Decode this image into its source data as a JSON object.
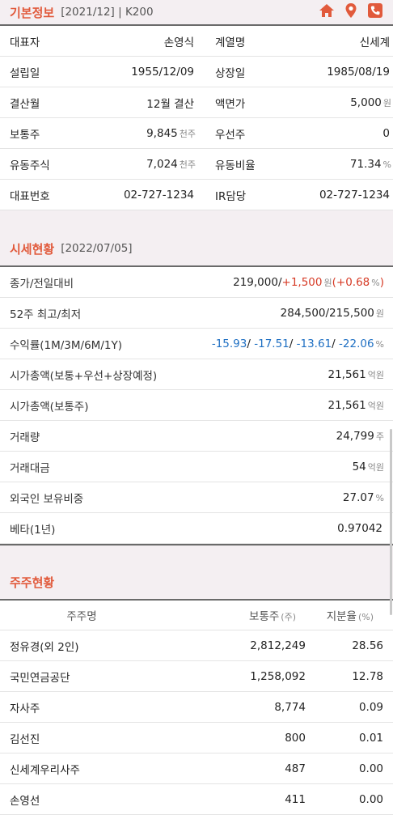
{
  "basic": {
    "title": "기본정보",
    "meta": "[2021/12]  |  K200",
    "icons": [
      "home-icon",
      "location-pin-icon",
      "phone-icon"
    ],
    "rows": [
      {
        "l1": "대표자",
        "v1": "손영식",
        "u1": "",
        "l2": "계열명",
        "v2": "신세계",
        "u2": ""
      },
      {
        "l1": "설립일",
        "v1": "1955/12/09",
        "u1": "",
        "l2": "상장일",
        "v2": "1985/08/19",
        "u2": ""
      },
      {
        "l1": "결산월",
        "v1": "12월 결산",
        "u1": "",
        "l2": "액면가",
        "v2": "5,000",
        "u2": "원"
      },
      {
        "l1": "보통주",
        "v1": "9,845",
        "u1": "천주",
        "l2": "우선주",
        "v2": "0",
        "u2": ""
      },
      {
        "l1": "유동주식",
        "v1": "7,024",
        "u1": "천주",
        "l2": "유동비율",
        "v2": "71.34",
        "u2": "%"
      },
      {
        "l1": "대표번호",
        "v1": "02-727-1234",
        "u1": "",
        "l2": "IR담당",
        "v2": "02-727-1234",
        "u2": ""
      }
    ]
  },
  "market": {
    "title": "시세현황",
    "date": "[2022/07/05]",
    "price": {
      "label": "종가/전일대비",
      "close": "219,000",
      "change": "+1,500",
      "unit": "원",
      "pct_open": "(",
      "pct": "+0.68",
      "pct_unit": "%",
      "pct_close": ")"
    },
    "week52": {
      "label": "52주 최고/최저",
      "value": "284,500/215,500",
      "unit": "원"
    },
    "returns": {
      "label": "수익률(1M/3M/6M/1Y)",
      "r1": "-15.93",
      "r2": "-17.51",
      "r3": "-13.61",
      "r4": "-22.06",
      "sep": "/",
      "unit": "%"
    },
    "rows": [
      {
        "label": "시가총액(보통+우선+상장예정)",
        "value": "21,561",
        "unit": "억원"
      },
      {
        "label": "시가총액(보통주)",
        "value": "21,561",
        "unit": "억원"
      },
      {
        "label": "거래량",
        "value": "24,799",
        "unit": "주"
      },
      {
        "label": "거래대금",
        "value": "54",
        "unit": "억원"
      },
      {
        "label": "외국인 보유비중",
        "value": "27.07",
        "unit": "%"
      },
      {
        "label": "베타(1년)",
        "value": "0.97042",
        "unit": ""
      }
    ]
  },
  "shareholders": {
    "title": "주주현황",
    "columns": {
      "name": "주주명",
      "count": "보통주",
      "count_unit": "(주)",
      "ratio": "지분율",
      "ratio_unit": "(%)"
    },
    "rows": [
      {
        "name": "정유경(외 2인)",
        "count": "2,812,249",
        "ratio": "28.56"
      },
      {
        "name": "국민연금공단",
        "count": "1,258,092",
        "ratio": "12.78"
      },
      {
        "name": "자사주",
        "count": "8,774",
        "ratio": "0.09"
      },
      {
        "name": "김선진",
        "count": "800",
        "ratio": "0.01"
      },
      {
        "name": "신세계우리사주",
        "count": "487",
        "ratio": "0.00"
      },
      {
        "name": "손영선",
        "count": "411",
        "ratio": "0.00"
      }
    ]
  },
  "colors": {
    "accent": "#e15a3c",
    "up": "#d63a25",
    "down": "#1e6fc3"
  }
}
